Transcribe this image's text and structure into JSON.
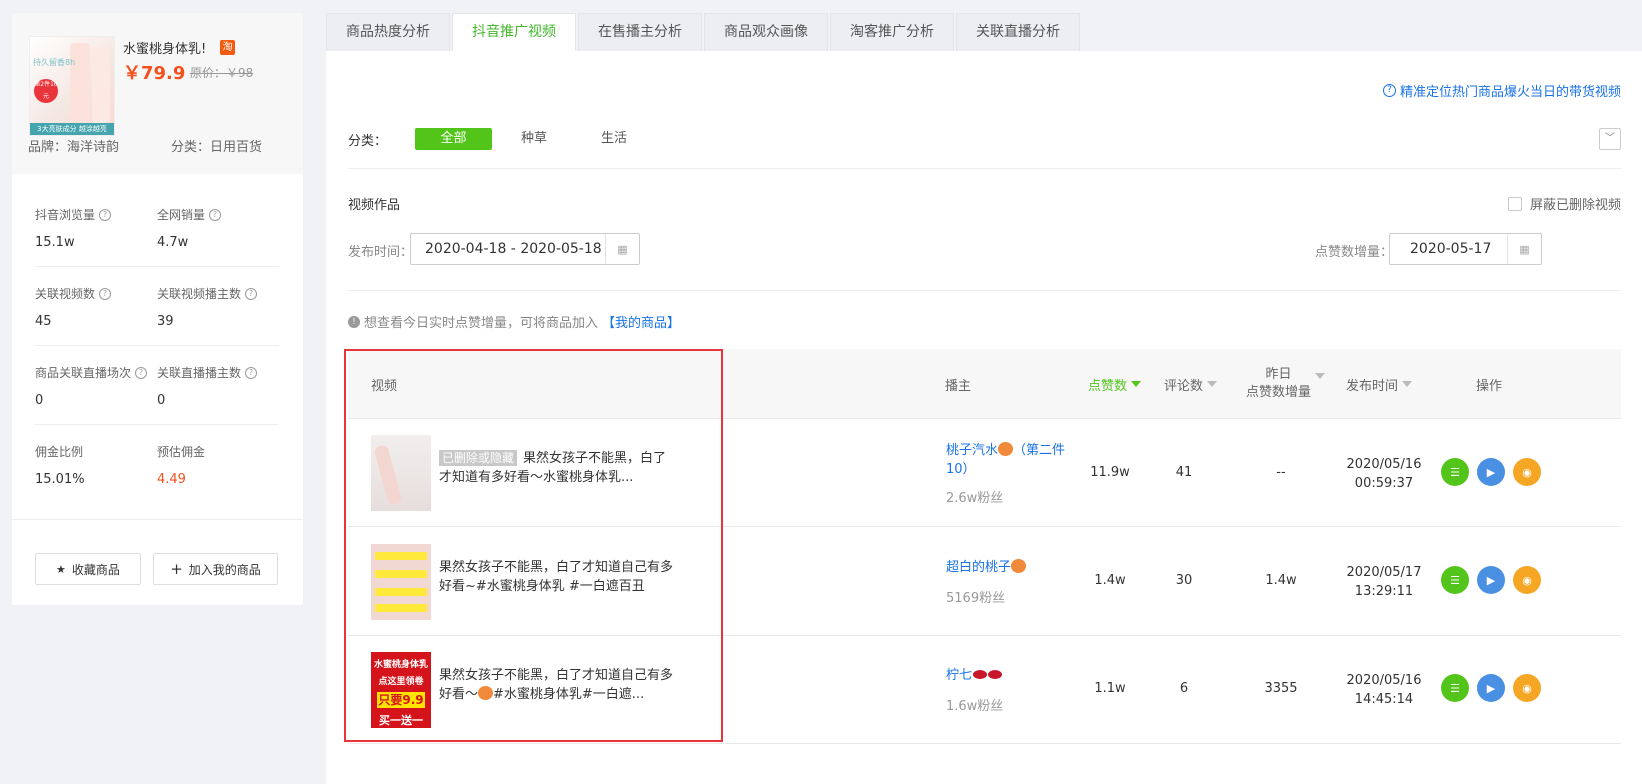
{
  "product": {
    "name": "水蜜桃身体乳!",
    "platform_icon": "淘",
    "price": "￥79.9",
    "original_price": "原价：￥98",
    "image_texts": {
      "top": "持久留香8h",
      "badge": "第2件10元",
      "bar": "3大亮肤成分 越涂越亮"
    },
    "brand": "品牌：海洋诗韵",
    "category": "分类：日用百货"
  },
  "stats": [
    {
      "label": "抖音浏览量",
      "value": "15.1w"
    },
    {
      "label": "全网销量",
      "value": "4.7w"
    },
    {
      "label": "关联视频数",
      "value": "45"
    },
    {
      "label": "关联视频播主数",
      "value": "39"
    },
    {
      "label": "商品关联直播场次",
      "value": "0"
    },
    {
      "label": "关联直播播主数",
      "value": "0"
    },
    {
      "label": "佣金比例",
      "value": "15.01%"
    },
    {
      "label": "预估佣金",
      "value": "4.49"
    }
  ],
  "buttons": {
    "favorite": "收藏商品",
    "add_mine": "加入我的商品"
  },
  "tabs": [
    "商品热度分析",
    "抖音推广视频",
    "在售播主分析",
    "商品观众画像",
    "淘客推广分析",
    "关联直播分析"
  ],
  "help_link": "精准定位热门商品爆火当日的带货视频",
  "filter": {
    "label": "分类：",
    "chips": [
      "全部",
      "种草",
      "生活"
    ]
  },
  "section_title": "视频作品",
  "hide_deleted": "屏蔽已删除视频",
  "publish_time": {
    "label": "发布时间：",
    "value": "2020-04-18 - 2020-05-18"
  },
  "like_increase": {
    "label": "点赞数增量：",
    "value": "2020-05-17"
  },
  "tip": {
    "text": "想查看今日实时点赞增量，可将商品加入",
    "link": "【我的商品】"
  },
  "columns": {
    "video": "视频",
    "author": "播主",
    "likes": "点赞数",
    "comments": "评论数",
    "yesterday_1": "昨日",
    "yesterday_2": "点赞数增量",
    "publish": "发布时间",
    "ops": "操作"
  },
  "rows": [
    {
      "deleted_tag": "已删除或隐藏",
      "title": "果然女孩子不能黑，白了才知道有多好看～水蜜桃身体乳...",
      "author": "桃子汽水",
      "author_suffix": "（第二件10）",
      "fans": "2.6w粉丝",
      "likes": "11.9w",
      "comments": "41",
      "increase": "--",
      "date": "2020/05/16",
      "time": "00:59:37"
    },
    {
      "title": "果然女孩子不能黑，白了才知道自己有多好看~#水蜜桃身体乳 #一白遮百丑",
      "author": "超白的桃子",
      "fans": "5169粉丝",
      "likes": "1.4w",
      "comments": "30",
      "increase": "1.4w",
      "date": "2020/05/17",
      "time": "13:29:11"
    },
    {
      "title_a": "果然女孩子不能黑，白了才知道自己有多好看～",
      "title_b": "#水蜜桃身体乳#一白遮...",
      "thumb_texts": [
        "水蜜桃身体乳",
        "点这里领卷",
        "只要9.9",
        "买一送一"
      ],
      "author": "柠七",
      "fans": "1.6w粉丝",
      "likes": "1.1w",
      "comments": "6",
      "increase": "3355",
      "date": "2020/05/16",
      "time": "14:45:14"
    }
  ],
  "colors": {
    "accent_green": "#52c41a",
    "price_red": "#f4511e",
    "link_blue": "#1a73e8",
    "highlight_box": "#e8343a"
  }
}
